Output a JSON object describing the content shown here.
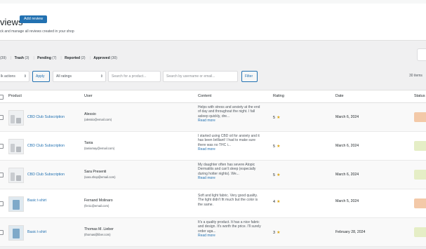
{
  "header": {
    "title": "views",
    "add_button": "Add review",
    "subtitle": "ck and manage all reviews created in your shop"
  },
  "filters": [
    {
      "label": "(39)",
      "count": ""
    },
    {
      "label": "Trash",
      "count": "(3)"
    },
    {
      "label": "Pending",
      "count": "(7)"
    },
    {
      "label": "Reported",
      "count": "(2)"
    },
    {
      "label": "Approved",
      "count": "(30)"
    }
  ],
  "toolbar": {
    "bulk_actions": "lk actions",
    "apply": "Apply",
    "ratings": "All ratings",
    "product_placeholder": "Search for a product...",
    "user_placeholder": "Search by username or email...",
    "filter": "Filter",
    "items_count": "30 items"
  },
  "table": {
    "columns": [
      "Product",
      "User",
      "Content",
      "Rating",
      "Date",
      "Status"
    ],
    "rows": [
      {
        "product": "CBD Club Subscription",
        "thumb": "bottles",
        "user": "Alessio",
        "email": "(alessio@email.com)",
        "content": "Helps with stress and anxiety at the end of day and throughout the night. I fall asleep quickly, dre...",
        "rating": "5",
        "date": "March 6, 2024",
        "status_color": "#f3c9a8"
      },
      {
        "product": "CBD Club Subscription",
        "thumb": "bottles",
        "user": "Tania",
        "email": "(taniamay@email.com)",
        "content": "I started using CBD oil for anxiety and it has been brilliant! I had to make sure there was no THC i...",
        "rating": "5",
        "date": "March 6, 2024",
        "status_color": "#e5eec6"
      },
      {
        "product": "CBD Club Subscription",
        "thumb": "bottles",
        "user": "Sara Presenti",
        "email": "(sara.shop@email.com)",
        "content": "My daughter often has severe Atopic Dermatitis and can't sleep (especially during hotter nights). We...",
        "rating": "5",
        "date": "March 6, 2024",
        "status_color": "#e5eec6"
      },
      {
        "product": "Basic t-shirt",
        "thumb": "shirt",
        "user": "Fernand Molinaro",
        "email": "(fer11@email.com)",
        "content": "Soft and light fabric. Very good quality. The light didn't fit much but the color is the same.",
        "rating": "4",
        "date": "March 5, 2024",
        "status_color": "#f3c9a8"
      },
      {
        "product": "Basic t-shirt",
        "thumb": "shirt",
        "user": "Thomas M. Lieber",
        "email": "(thomas@liber.com)",
        "content": "It's a quality product. It has a nice fabric and design. It's worth the price. I'll surely order aga...",
        "rating": "3",
        "date": "February 28, 2024",
        "status_color": "#e5eec6"
      }
    ],
    "read_more": "Read more"
  },
  "colors": {
    "accent": "#2271b1",
    "star": "#dba617"
  }
}
